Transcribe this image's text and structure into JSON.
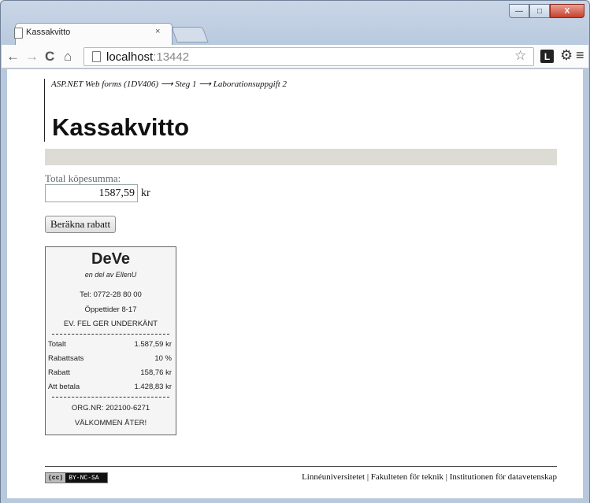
{
  "browser": {
    "tab_title": "Kassakvitto",
    "tab_close": "×",
    "url_host": "localhost",
    "url_port": ":13442",
    "ext_button": "L",
    "window_buttons": {
      "minimize": "—",
      "maximize": "□",
      "close": "X"
    },
    "icons": {
      "back": "←",
      "forward": "→",
      "reload": "C",
      "home": "⌂",
      "star": "☆",
      "settings": "⚙",
      "menu": "≡"
    }
  },
  "page": {
    "breadcrumb": "ASP.NET Web forms (1DV406) ⟶ Steg 1 ⟶ Laborationsuppgift 2",
    "title": "Kassakvitto",
    "total_label": "Total köpesumma:",
    "total_value": "1587,59",
    "currency": "kr",
    "calc_button": "Beräkna rabatt"
  },
  "receipt": {
    "store_name": "DeVe",
    "store_sub": "en del av EllenU",
    "phone": "Tel: 0772-28 80 00",
    "hours": "Öppettider 8-17",
    "warning": "EV. FEL GER UNDERKÄNT",
    "rows": [
      {
        "label": "Totalt",
        "value": "1.587,59 kr"
      },
      {
        "label": "Rabattsats",
        "value": "10 %"
      },
      {
        "label": "Rabatt",
        "value": "158,76 kr"
      },
      {
        "label": "Att betala",
        "value": "1.428,83 kr"
      }
    ],
    "org_nr": "ORG.NR: 202100-6271",
    "farewell": "VÄLKOMMEN ÅTER!"
  },
  "footer": {
    "license_left": "(cc)",
    "license_right": "BY-NC-SA",
    "text": "Linnéuniversitetet | Fakulteten för teknik | Institutionen för datavetenskap"
  }
}
